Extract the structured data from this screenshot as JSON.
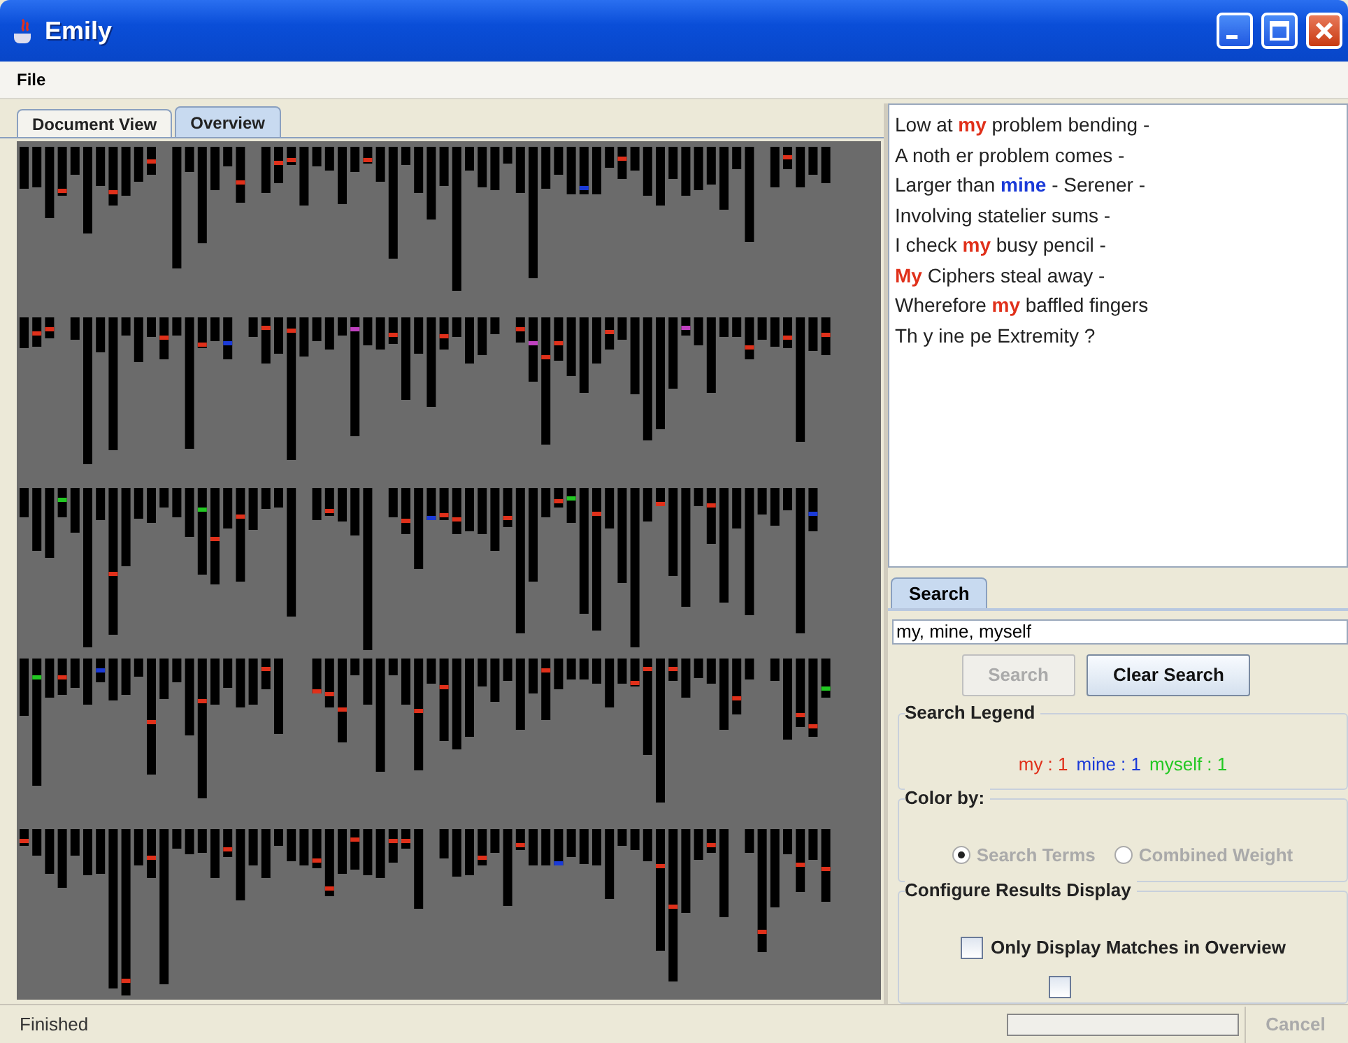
{
  "window": {
    "title": "Emily"
  },
  "menu": [
    {
      "label": "File"
    }
  ],
  "view_tabs": [
    {
      "label": "Document View",
      "selected": false
    },
    {
      "label": "Overview",
      "selected": true
    }
  ],
  "document_text": [
    [
      {
        "text": "Low at "
      },
      {
        "text": "my",
        "color": "#e0301a"
      },
      {
        "text": " problem bending -"
      }
    ],
    [
      {
        "text": "A noth er problem comes -"
      }
    ],
    [
      {
        "text": "Larger than "
      },
      {
        "text": "mine",
        "color": "#1a3ad8"
      },
      {
        "text": " - Serener -"
      }
    ],
    [
      {
        "text": "Involving statelier sums -"
      }
    ],
    [
      {
        "text": "I check "
      },
      {
        "text": "my",
        "color": "#e0301a"
      },
      {
        "text": " busy pencil -"
      }
    ],
    [
      {
        "text": "My",
        "color": "#e0301a"
      },
      {
        "text": " Ciphers steal away -"
      }
    ],
    [
      {
        "text": "Wherefore "
      },
      {
        "text": "my",
        "color": "#e0301a"
      },
      {
        "text": " baffled fingers"
      }
    ],
    [
      {
        "text": "Th y ine pe Extremity ?"
      }
    ]
  ],
  "search_tabs": [
    {
      "label": "Search",
      "selected": true
    }
  ],
  "search_field": {
    "value": "my, mine, myself"
  },
  "buttons": [
    {
      "label": "Search",
      "disabled": true
    },
    {
      "label": "Clear Search",
      "disabled": false
    }
  ],
  "search_legend": {
    "title": "Search Legend",
    "items": [
      {
        "text": "my : 1",
        "color": "#e0301a"
      },
      {
        "text": "mine : 1",
        "color": "#1a3ad8"
      },
      {
        "text": "myself : 1",
        "color": "#22c822"
      }
    ]
  },
  "color_by": {
    "title": "Color by:",
    "options": [
      {
        "label": "Search Terms",
        "selected": true,
        "disabled": true
      },
      {
        "label": "Combined Weight",
        "selected": false,
        "disabled": true
      }
    ]
  },
  "configure": {
    "title": "Configure Results Display",
    "options": [
      {
        "label": "Only Display Matches in Overview",
        "checked": false
      }
    ],
    "clipped_checkbox": {
      "checked": false
    }
  },
  "status_bar": {
    "text": "Finished",
    "progress": {
      "level": 0
    },
    "cancel": {
      "label": "Cancel",
      "disabled": true
    }
  }
}
